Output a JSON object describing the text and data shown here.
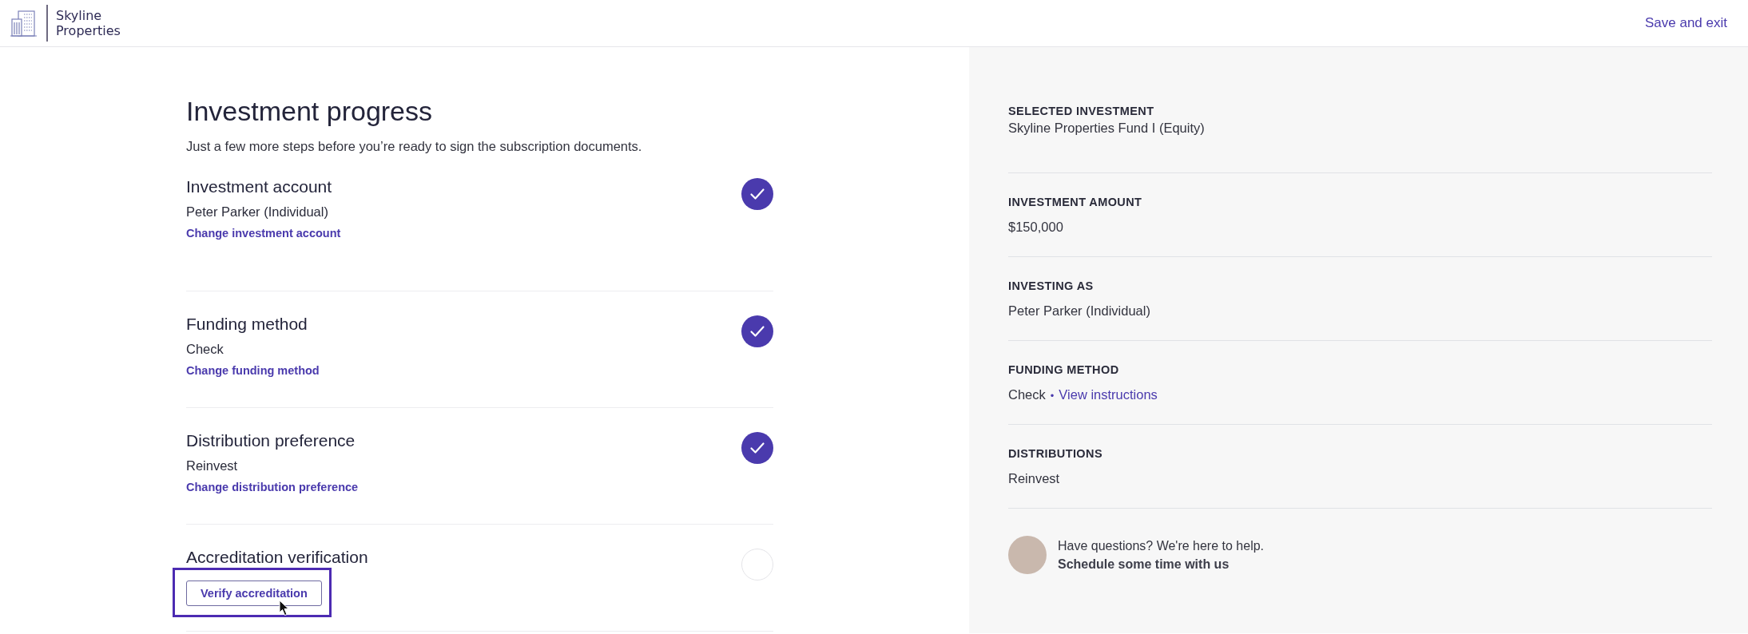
{
  "header": {
    "brand_line_1": "Skyline",
    "brand_line_2": "Properties",
    "save_link": "Save and exit"
  },
  "progress": {
    "title": "Investment progress",
    "subtitle": "Just a few more steps before you’re ready to sign the subscription documents.",
    "steps": [
      {
        "title": "Investment account",
        "completed": true,
        "value": "Peter Parker (Individual)",
        "link": "Change investment account"
      },
      {
        "title": "Funding method",
        "completed": true,
        "value": "Check",
        "link": "Change funding method"
      },
      {
        "title": "Distribution preference",
        "completed": true,
        "value": "Reinvest",
        "link": "Change distribution preference"
      },
      {
        "title": "Accreditation verification",
        "completed": false,
        "button": {
          "label": "Verify accreditation",
          "highlighted": true
        }
      }
    ]
  },
  "summary": {
    "items": [
      {
        "label": "SELECTED INVESTMENT",
        "value": "Skyline Properties Fund I (Equity)"
      },
      {
        "label": "INVESTMENT AMOUNT",
        "value": "$150,000"
      },
      {
        "label": "INVESTING AS",
        "value": "Peter Parker (Individual)"
      },
      {
        "label": "FUNDING METHOD",
        "value": "Check",
        "separator": "•",
        "link": "View instructions"
      },
      {
        "label": "DISTRIBUTIONS",
        "value": "Reinvest"
      }
    ],
    "help": {
      "text": "Have questions? We're here to help.",
      "link": "Schedule some time with us"
    }
  }
}
